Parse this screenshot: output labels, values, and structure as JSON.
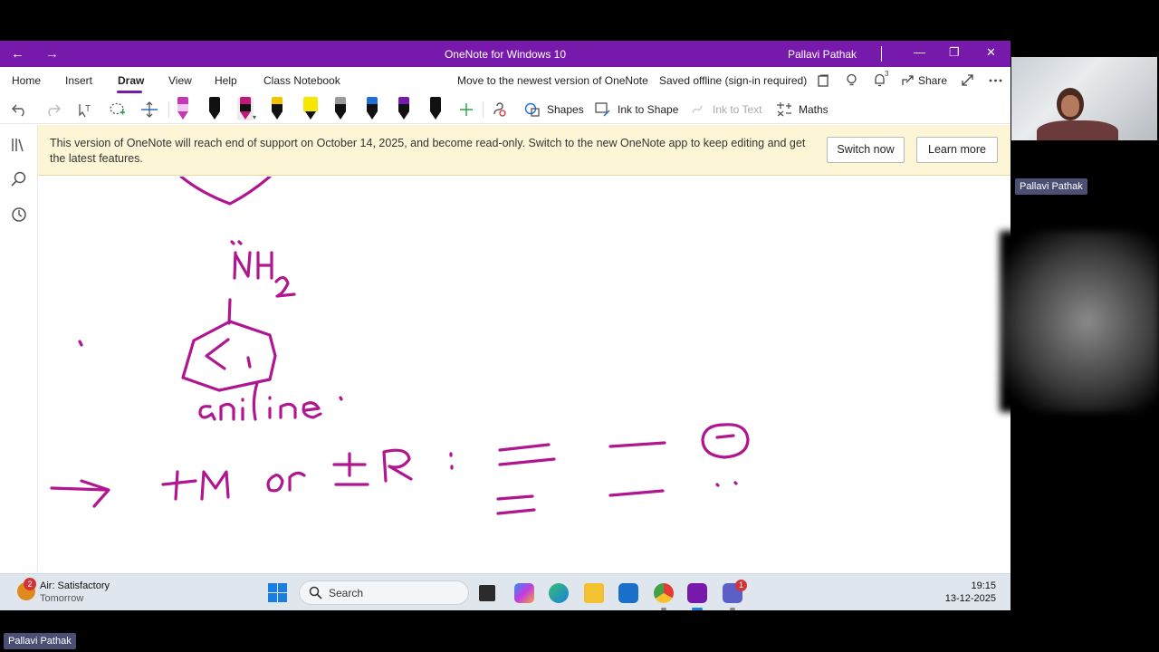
{
  "window": {
    "title": "OneNote for Windows 10",
    "user": "Pallavi Pathak",
    "back_glyph": "←",
    "forward_glyph": "→",
    "minimize_glyph": "—",
    "restore_glyph": "❐",
    "close_glyph": "✕",
    "accent": "#7719aa"
  },
  "menu": {
    "tabs": [
      "Home",
      "Insert",
      "Draw",
      "View",
      "Help",
      "Class Notebook"
    ],
    "active_tab": "Draw",
    "upgrade_link": "Move to the newest version of OneNote",
    "sync_status": "Saved offline (sign-in required)",
    "share_label": "Share",
    "notification_count": "3"
  },
  "toolbar": {
    "shapes_label": "Shapes",
    "ink_to_shape_label": "Ink to Shape",
    "ink_to_text_label": "Ink to Text",
    "maths_label": "Maths",
    "pen_colors": [
      "#c239b3",
      "#111111",
      "#c2187c",
      "#f2c400",
      "#f7e600",
      "#9a9a9a",
      "#1e6fd9",
      "#7719aa",
      "#111111"
    ],
    "ink_color": "#b0168f"
  },
  "notice": {
    "text": "This version of OneNote will reach end of support on October 14, 2025, and become read-only. Switch to the new OneNote app to keep editing and get the latest features.",
    "switch_button": "Switch now",
    "learn_button": "Learn more"
  },
  "taskbar": {
    "weather_title": "Air: Satisfactory",
    "weather_subtitle": "Tomorrow",
    "weather_badge": "2",
    "search_placeholder": "Search",
    "teams_badge": "1",
    "time": "19:15",
    "date": "13-12-2025"
  },
  "meeting": {
    "participant_label": "Pallavi Pathak",
    "presenter_label": "Pallavi Pathak"
  }
}
